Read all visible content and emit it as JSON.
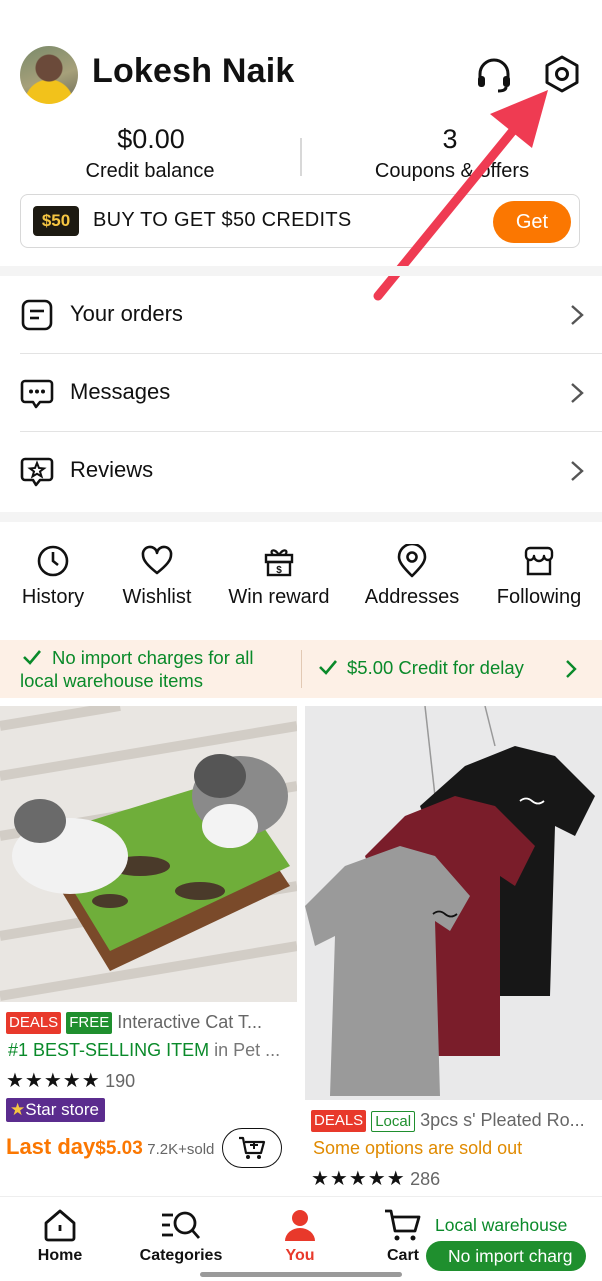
{
  "profile": {
    "name": "Lokesh Naik"
  },
  "header_icons": [
    "headset-icon",
    "settings-icon"
  ],
  "stats": {
    "credit_value": "$0.00",
    "credit_label": "Credit balance",
    "coupons_value": "3",
    "coupons_label": "Coupons & offers"
  },
  "promo": {
    "badge": "$50",
    "text": "BUY TO GET $50 CREDITS",
    "button": "Get"
  },
  "menu": [
    {
      "label": "Your orders",
      "icon": "orders-icon"
    },
    {
      "label": "Messages",
      "icon": "messages-icon"
    },
    {
      "label": "Reviews",
      "icon": "reviews-icon"
    }
  ],
  "quick_actions": [
    {
      "label": "History",
      "icon": "clock-icon"
    },
    {
      "label": "Wishlist",
      "icon": "heart-icon"
    },
    {
      "label": "Win reward",
      "icon": "gift-icon"
    },
    {
      "label": "Addresses",
      "icon": "location-pin-icon"
    },
    {
      "label": "Following",
      "icon": "store-icon"
    }
  ],
  "info_bar": {
    "left": "No import charges for all local warehouse items",
    "right": "$5.00 Credit for delay"
  },
  "products": [
    {
      "tags": [
        "DEALS",
        "FREE"
      ],
      "title": "Interactive Cat T...",
      "highlight": "#1 BEST-SELLING ITEM",
      "highlight_suffix": "in Pet ...",
      "stars": "★★★★★",
      "reviews": "190",
      "store_badge": "Star store",
      "price_prefix": "Last day",
      "price": "$5.03",
      "sold": "7.2K+sold"
    },
    {
      "tags": [
        "DEALS",
        "Local"
      ],
      "title": "3pcs s' Pleated Ro...",
      "note": "Some options are sold out",
      "stars": "★★★★★",
      "reviews": "286"
    }
  ],
  "bottom_nav": [
    {
      "label": "Home",
      "icon": "home-icon"
    },
    {
      "label": "Categories",
      "icon": "categories-search-icon"
    },
    {
      "label": "You",
      "icon": "user-icon",
      "active": true
    },
    {
      "label": "Cart",
      "icon": "cart-icon"
    }
  ],
  "local_warehouse": {
    "title": "Local warehouse",
    "pill": "No import charg"
  },
  "colors": {
    "accent": "#fb7701",
    "green": "#0a8a2a",
    "active_nav": "#e8392b",
    "deal_red": "#e8392b"
  }
}
